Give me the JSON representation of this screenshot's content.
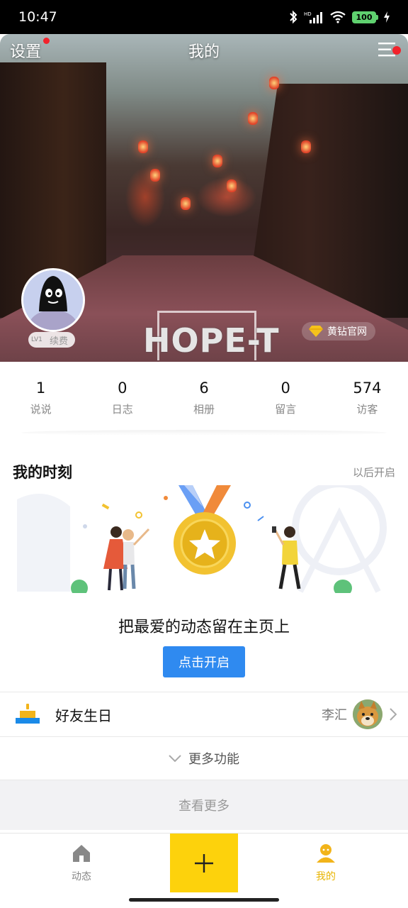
{
  "status_bar": {
    "time": "10:47",
    "battery": "100",
    "icons": [
      "bluetooth-icon",
      "hd-signal-icon",
      "wifi-icon",
      "battery-icon",
      "charging-icon"
    ]
  },
  "header": {
    "settings_label": "设置",
    "title": "我的",
    "menu_icon": "menu-icon",
    "cover_logo_text": "HOPE-T",
    "renew_badge": "续费",
    "renew_level": "LV1",
    "yellow_diamond_label": "黄钻官网"
  },
  "stats": [
    {
      "value": "1",
      "label": "说说"
    },
    {
      "value": "0",
      "label": "日志"
    },
    {
      "value": "6",
      "label": "相册"
    },
    {
      "value": "0",
      "label": "留言"
    },
    {
      "value": "574",
      "label": "访客"
    }
  ],
  "moments": {
    "title": "我的时刻",
    "later_label": "以后开启",
    "promo_text": "把最爱的动态留在主页上",
    "button_label": "点击开启"
  },
  "birthday": {
    "label": "好友生日",
    "friend_name": "李汇"
  },
  "more_features_label": "更多功能",
  "view_more_label": "查看更多",
  "bottom_nav": {
    "feed_label": "动态",
    "mine_label": "我的",
    "active": "mine"
  },
  "colors": {
    "accent_blue": "#2f8af0",
    "accent_yellow": "#fdd20c",
    "active_nav": "#e8b400",
    "badge_red": "#f2222b"
  }
}
